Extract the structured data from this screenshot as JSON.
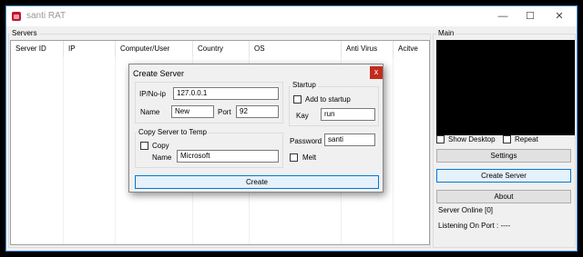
{
  "window": {
    "title": "santi RAT",
    "controls": {
      "minimize": "—",
      "maximize": "☐",
      "close": "✕"
    }
  },
  "servers": {
    "label": "Servers",
    "columns": [
      "Server ID",
      "IP",
      "Computer/User",
      "Country",
      "OS",
      "Anti Virus",
      "Acitve"
    ]
  },
  "main": {
    "label": "Main",
    "show_desktop": "Show Desktop",
    "repeat": "Repeat",
    "settings": "Settings",
    "create_server": "Create Server",
    "about": "About",
    "server_online": "Server Online [0]",
    "listening_on_port": "Listening On Port : ----"
  },
  "dialog": {
    "title": "Create Server",
    "close": "x",
    "ip_label": "IP/No-ip",
    "ip_value": "127.0.0.1",
    "name_label": "Name",
    "name_value": "New",
    "port_label": "Port",
    "port_value": "92",
    "startup_group": "Startup",
    "add_to_startup": "Add to startup",
    "kay_label": "Kay",
    "kay_value": "run",
    "copy_group": "Copy Server to Temp",
    "copy_label": "Copy",
    "copy_name_label": "Name",
    "copy_name_value": "Microsoft",
    "password_label": "Password",
    "password_value": "santi",
    "melt_label": "Melt",
    "create_button": "Create"
  }
}
